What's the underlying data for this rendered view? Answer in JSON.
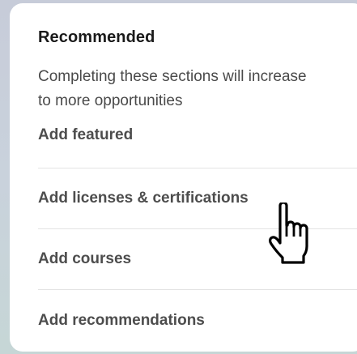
{
  "recommended": {
    "title": "Recommended",
    "description_line1": "Completing these sections will increase",
    "description_line2": "to more opportunities",
    "items": [
      {
        "label": "Add featured"
      },
      {
        "label": "Add licenses & certifications"
      },
      {
        "label": "Add courses"
      },
      {
        "label": "Add recommendations"
      }
    ]
  },
  "colors": {
    "card_background": "#ffffff",
    "title_text": "#1a1a1a",
    "body_text": "#4a4a4a",
    "divider": "#e3e3e3"
  },
  "cursor": {
    "icon": "hand-pointer-icon"
  }
}
